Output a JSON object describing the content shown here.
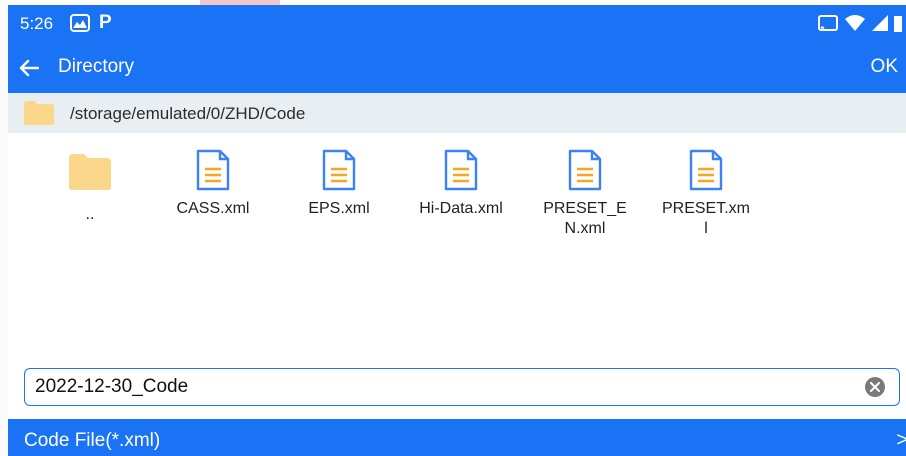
{
  "status": {
    "time": "5:26",
    "icons": [
      "photos-icon",
      "p-icon",
      "cast-icon",
      "wifi-icon",
      "signal-icon",
      "battery-icon"
    ],
    "p_glyph": "P"
  },
  "appbar": {
    "title": "Directory",
    "ok_label": "OK"
  },
  "path": {
    "text": "/storage/emulated/0/ZHD/Code"
  },
  "files": [
    {
      "name": "..",
      "type": "folder"
    },
    {
      "name": "CASS.xml",
      "type": "file"
    },
    {
      "name": "EPS.xml",
      "type": "file"
    },
    {
      "name": "Hi-Data.xml",
      "type": "file"
    },
    {
      "name": "PRESET_E\nN.xml",
      "type": "file"
    },
    {
      "name": "PRESET.xm\nl",
      "type": "file"
    }
  ],
  "filename_input": {
    "value": "2022-12-30_Code"
  },
  "filter": {
    "label": "Code File(*.xml)",
    "chevron": ">"
  },
  "colors": {
    "primary": "#1a73f5",
    "folder": "#fbd78c",
    "file_icon": "#3b82f6",
    "file_lines": "#f5a623"
  }
}
